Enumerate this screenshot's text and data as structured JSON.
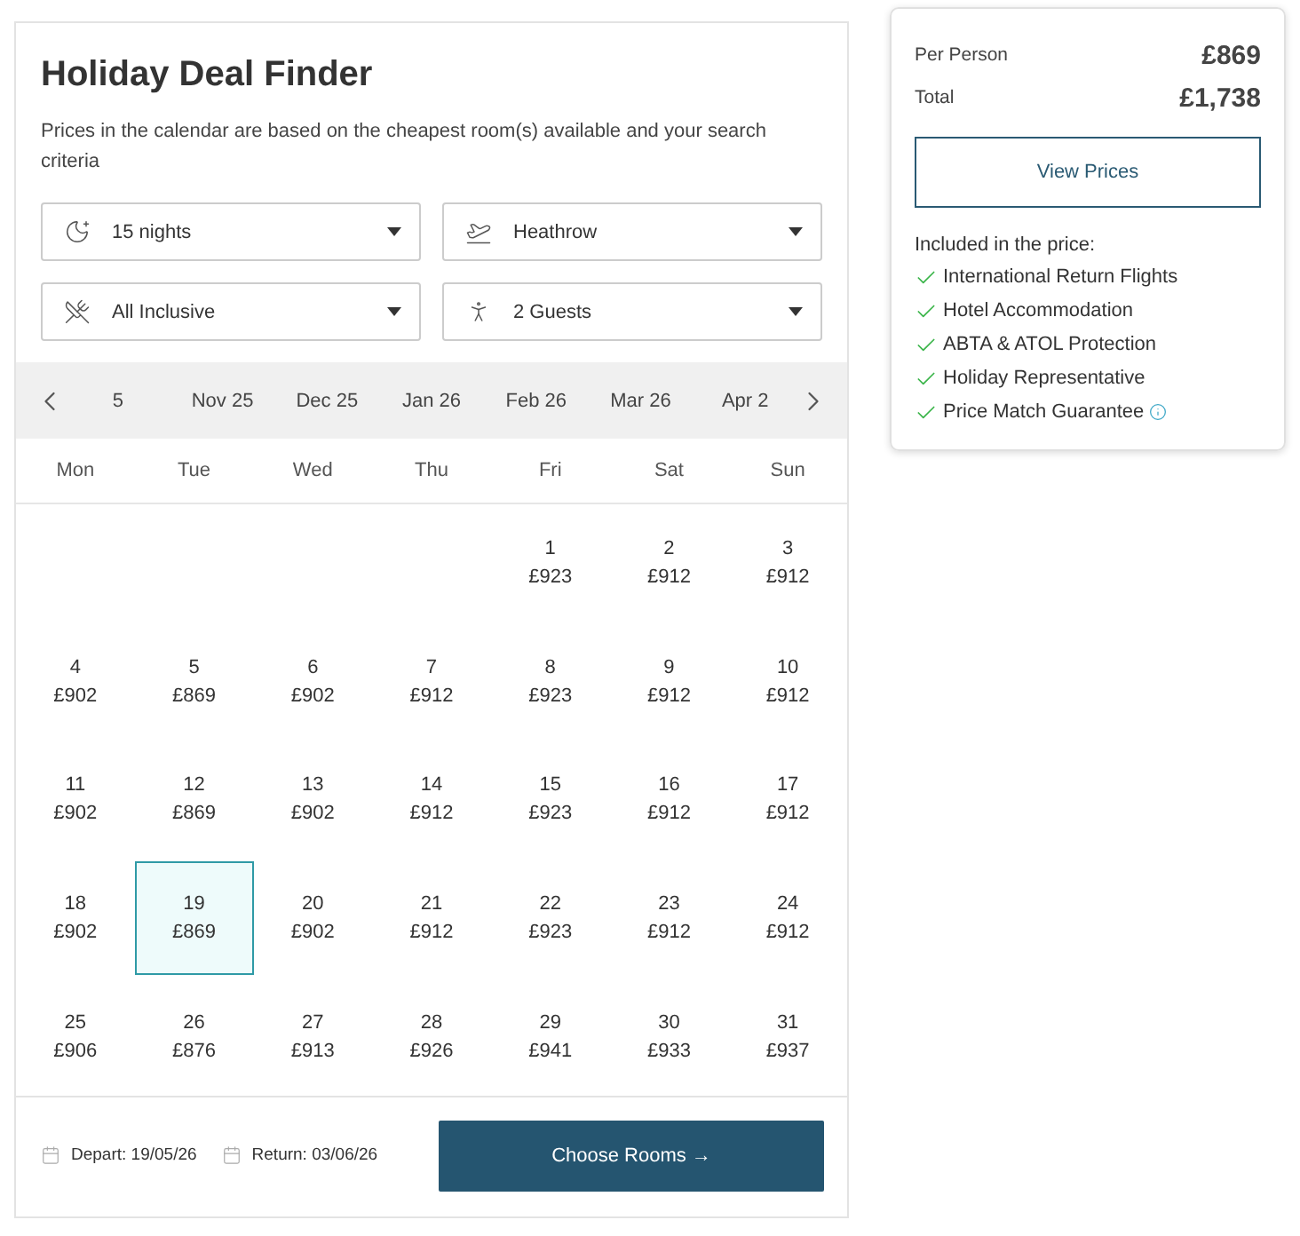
{
  "finder": {
    "title": "Holiday Deal Finder",
    "subtitle": "Prices in the calendar are based on the cheapest room(s) available and your search criteria",
    "filters": [
      {
        "kind": "nights",
        "value": "15 nights"
      },
      {
        "kind": "airport",
        "value": "Heathrow"
      },
      {
        "kind": "board",
        "value": "All Inclusive"
      },
      {
        "kind": "guests",
        "value": "2 Guests"
      }
    ],
    "months": [
      "5",
      "Nov 25",
      "Dec 25",
      "Jan 26",
      "Feb 26",
      "Mar 26",
      "Apr 2"
    ],
    "weekdays": [
      "Mon",
      "Tue",
      "Wed",
      "Thu",
      "Fri",
      "Sat",
      "Sun"
    ],
    "weeks": [
      [
        {
          "kind": "empty"
        },
        {
          "kind": "empty"
        },
        {
          "kind": "empty"
        },
        {
          "kind": "empty"
        },
        {
          "kind": "day",
          "day": "1",
          "price": "£923",
          "selected": false
        },
        {
          "kind": "day",
          "day": "2",
          "price": "£912",
          "selected": false
        },
        {
          "kind": "day",
          "day": "3",
          "price": "£912",
          "selected": false
        }
      ],
      [
        {
          "kind": "day",
          "day": "4",
          "price": "£902",
          "selected": false
        },
        {
          "kind": "day",
          "day": "5",
          "price": "£869",
          "selected": false
        },
        {
          "kind": "day",
          "day": "6",
          "price": "£902",
          "selected": false
        },
        {
          "kind": "day",
          "day": "7",
          "price": "£912",
          "selected": false
        },
        {
          "kind": "day",
          "day": "8",
          "price": "£923",
          "selected": false
        },
        {
          "kind": "day",
          "day": "9",
          "price": "£912",
          "selected": false
        },
        {
          "kind": "day",
          "day": "10",
          "price": "£912",
          "selected": false
        }
      ],
      [
        {
          "kind": "day",
          "day": "11",
          "price": "£902",
          "selected": false
        },
        {
          "kind": "day",
          "day": "12",
          "price": "£869",
          "selected": false
        },
        {
          "kind": "day",
          "day": "13",
          "price": "£902",
          "selected": false
        },
        {
          "kind": "day",
          "day": "14",
          "price": "£912",
          "selected": false
        },
        {
          "kind": "day",
          "day": "15",
          "price": "£923",
          "selected": false
        },
        {
          "kind": "day",
          "day": "16",
          "price": "£912",
          "selected": false
        },
        {
          "kind": "day",
          "day": "17",
          "price": "£912",
          "selected": false
        }
      ],
      [
        {
          "kind": "day",
          "day": "18",
          "price": "£902",
          "selected": false
        },
        {
          "kind": "day",
          "day": "19",
          "price": "£869",
          "selected": true
        },
        {
          "kind": "day",
          "day": "20",
          "price": "£902",
          "selected": false
        },
        {
          "kind": "day",
          "day": "21",
          "price": "£912",
          "selected": false
        },
        {
          "kind": "day",
          "day": "22",
          "price": "£923",
          "selected": false
        },
        {
          "kind": "day",
          "day": "23",
          "price": "£912",
          "selected": false
        },
        {
          "kind": "day",
          "day": "24",
          "price": "£912",
          "selected": false
        }
      ],
      [
        {
          "kind": "day",
          "day": "25",
          "price": "£906",
          "selected": false
        },
        {
          "kind": "day",
          "day": "26",
          "price": "£876",
          "selected": false
        },
        {
          "kind": "day",
          "day": "27",
          "price": "£913",
          "selected": false
        },
        {
          "kind": "day",
          "day": "28",
          "price": "£926",
          "selected": false
        },
        {
          "kind": "day",
          "day": "29",
          "price": "£941",
          "selected": false
        },
        {
          "kind": "day",
          "day": "30",
          "price": "£933",
          "selected": false
        },
        {
          "kind": "day",
          "day": "31",
          "price": "£937",
          "selected": false
        }
      ]
    ],
    "depart": "Depart: 19/05/26",
    "return": "Return: 03/06/26",
    "button": "Choose Rooms →"
  },
  "summary": {
    "rows": [
      {
        "label": "Per Person",
        "value": "£869"
      },
      {
        "label": "Total",
        "value": "£1,738"
      }
    ],
    "button": "View Prices",
    "included_title": "Included in the price:",
    "included": [
      {
        "text": "International Return Flights",
        "info": false
      },
      {
        "text": "Hotel Accommodation",
        "info": false
      },
      {
        "text": "ABTA & ATOL Protection",
        "info": false
      },
      {
        "text": "Holiday Representative",
        "info": false
      },
      {
        "text": "Price Match Guarantee",
        "info": true
      }
    ]
  }
}
